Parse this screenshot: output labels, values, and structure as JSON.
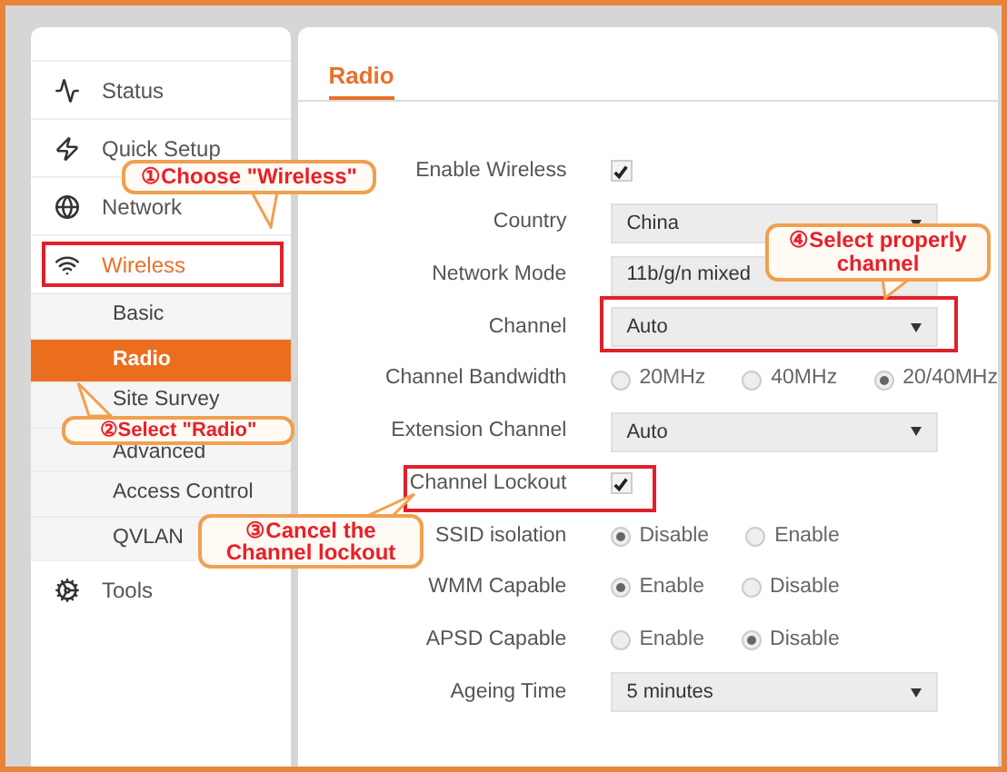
{
  "sidebar": {
    "items": [
      {
        "label": "Status",
        "selected": false
      },
      {
        "label": "Quick Setup",
        "selected": false
      },
      {
        "label": "Network",
        "selected": false
      },
      {
        "label": "Wireless",
        "selected": true,
        "children": [
          {
            "label": "Basic",
            "selected": false
          },
          {
            "label": "Radio",
            "selected": true
          },
          {
            "label": "Site Survey",
            "selected": false
          },
          {
            "label": "Advanced",
            "selected": false
          },
          {
            "label": "Access Control",
            "selected": false
          },
          {
            "label": "QVLAN",
            "selected": false
          }
        ]
      },
      {
        "label": "Tools",
        "selected": false
      }
    ]
  },
  "tab": {
    "label": "Radio",
    "selected": true
  },
  "form": [
    {
      "label": "Enable Wireless",
      "kind": "checkbox",
      "checked": true
    },
    {
      "label": "Country",
      "kind": "select",
      "value": "China"
    },
    {
      "label": "Network Mode",
      "kind": "select",
      "value": "11b/g/n mixed"
    },
    {
      "label": "Channel",
      "kind": "select",
      "value": "Auto"
    },
    {
      "label": "Channel Bandwidth",
      "kind": "radio",
      "options": [
        {
          "label": "20MHz",
          "selected": false
        },
        {
          "label": "40MHz",
          "selected": false
        },
        {
          "label": "20/40MHz",
          "selected": true
        }
      ]
    },
    {
      "label": "Extension Channel",
      "kind": "select",
      "value": "Auto"
    },
    {
      "label": "Channel Lockout",
      "kind": "checkbox",
      "checked": true
    },
    {
      "label": "SSID isolation",
      "kind": "radio",
      "options": [
        {
          "label": "Disable",
          "selected": true
        },
        {
          "label": "Enable",
          "selected": false
        }
      ]
    },
    {
      "label": "WMM Capable",
      "kind": "radio",
      "options": [
        {
          "label": "Enable",
          "selected": true
        },
        {
          "label": "Disable",
          "selected": false
        }
      ]
    },
    {
      "label": "APSD Capable",
      "kind": "radio",
      "options": [
        {
          "label": "Enable",
          "selected": false
        },
        {
          "label": "Disable",
          "selected": true
        }
      ]
    },
    {
      "label": "Ageing Time",
      "kind": "select",
      "value": "5 minutes"
    }
  ],
  "callouts": [
    "①Choose \"Wireless\"",
    "②Select \"Radio\"",
    "③Cancel the Channel lockout",
    "④Select properly channel"
  ]
}
